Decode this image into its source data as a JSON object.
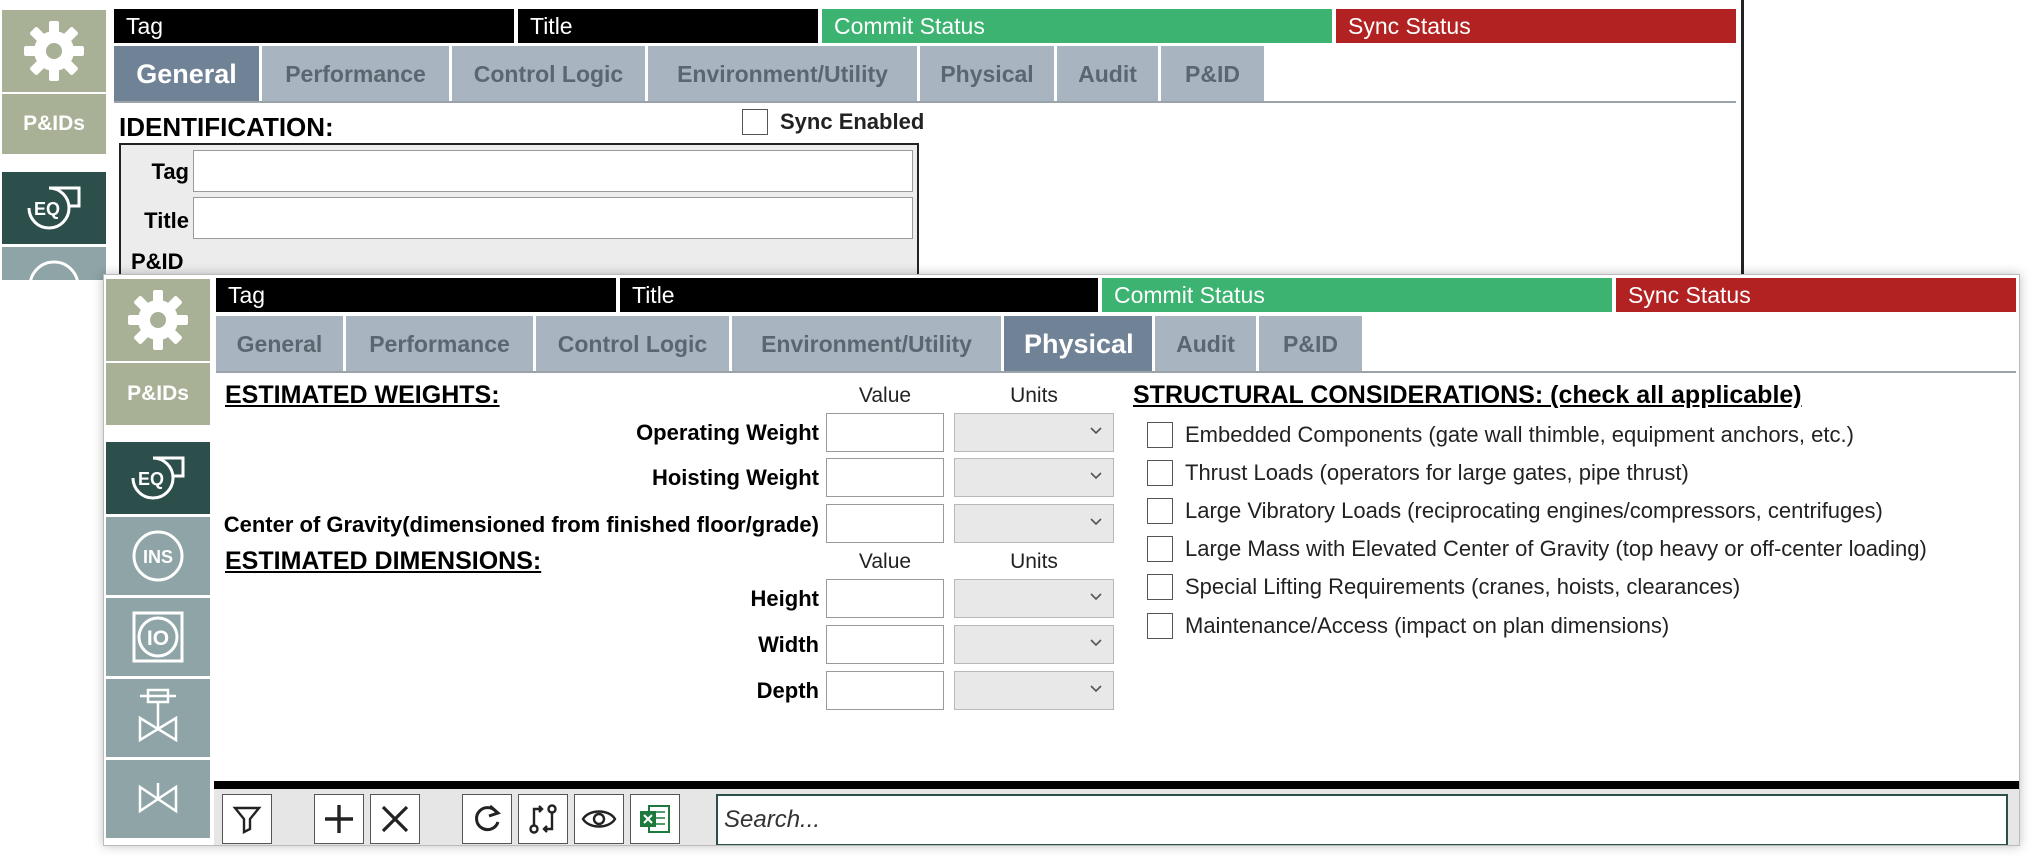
{
  "back_window": {
    "header": {
      "tag": "Tag",
      "title": "Title",
      "commit_status": "Commit Status",
      "sync_status": "Sync Status"
    },
    "tabs": [
      "General",
      "Performance",
      "Control Logic",
      "Environment/Utility",
      "Physical",
      "Audit",
      "P&ID"
    ],
    "active_tab": "General",
    "identification": {
      "heading": "IDENTIFICATION:",
      "sync_enabled_label": "Sync Enabled",
      "tag_label": "Tag",
      "title_label": "Title",
      "pid_label": "P&ID"
    },
    "sidebar": {
      "pid_label": "P&IDs",
      "eq_icon": "equipment-icon",
      "ins_icon": "instrument-icon",
      "io_icon": "io-icon",
      "valve_actuated_icon": "actuated-valve-icon",
      "valve_icon": "valve-icon"
    }
  },
  "front_window": {
    "header": {
      "tag": "Tag",
      "title": "Title",
      "commit_status": "Commit Status",
      "sync_status": "Sync Status"
    },
    "tabs": [
      "General",
      "Performance",
      "Control Logic",
      "Environment/Utility",
      "Physical",
      "Audit",
      "P&ID"
    ],
    "active_tab": "Physical",
    "sidebar": {
      "pid_label": "P&IDs"
    },
    "weights": {
      "heading": "ESTIMATED WEIGHTS:",
      "value_col": "Value",
      "units_col": "Units",
      "rows": [
        {
          "label": "Operating Weight",
          "value": "",
          "units": ""
        },
        {
          "label": "Hoisting Weight",
          "value": "",
          "units": ""
        },
        {
          "label": "Center of Gravity(dimensioned from finished floor/grade)",
          "value": "",
          "units": ""
        }
      ]
    },
    "dimensions": {
      "heading": "ESTIMATED DIMENSIONS:",
      "value_col": "Value",
      "units_col": "Units",
      "rows": [
        {
          "label": "Height",
          "value": "",
          "units": ""
        },
        {
          "label": "Width",
          "value": "",
          "units": ""
        },
        {
          "label": "Depth",
          "value": "",
          "units": ""
        }
      ]
    },
    "structural": {
      "heading": "STRUCTURAL CONSIDERATIONS: (check all applicable)",
      "items": [
        {
          "label": "Embedded Components (gate wall thimble, equipment anchors, etc.)",
          "checked": false
        },
        {
          "label": "Thrust Loads (operators for large gates, pipe thrust)",
          "checked": false
        },
        {
          "label": "Large Vibratory Loads (reciprocating engines/compressors, centrifuges)",
          "checked": false
        },
        {
          "label": "Large Mass with Elevated Center of Gravity (top heavy or off-center loading)",
          "checked": false
        },
        {
          "label": "Special Lifting Requirements (cranes, hoists, clearances)",
          "checked": false
        },
        {
          "label": "Maintenance/Access (impact on plan dimensions)",
          "checked": false
        }
      ]
    },
    "toolbar": {
      "search_placeholder": "Search..."
    }
  },
  "colors": {
    "tag_bg": "#000000",
    "commit_bg": "#3cb371",
    "sync_bg": "#b22222",
    "tab_active": "#6f8296",
    "tab_inactive": "#a8b5c0",
    "sidebar_olive": "#a8b096",
    "sidebar_dark": "#2d4f4c",
    "sidebar_mid": "#8ea4a6"
  }
}
